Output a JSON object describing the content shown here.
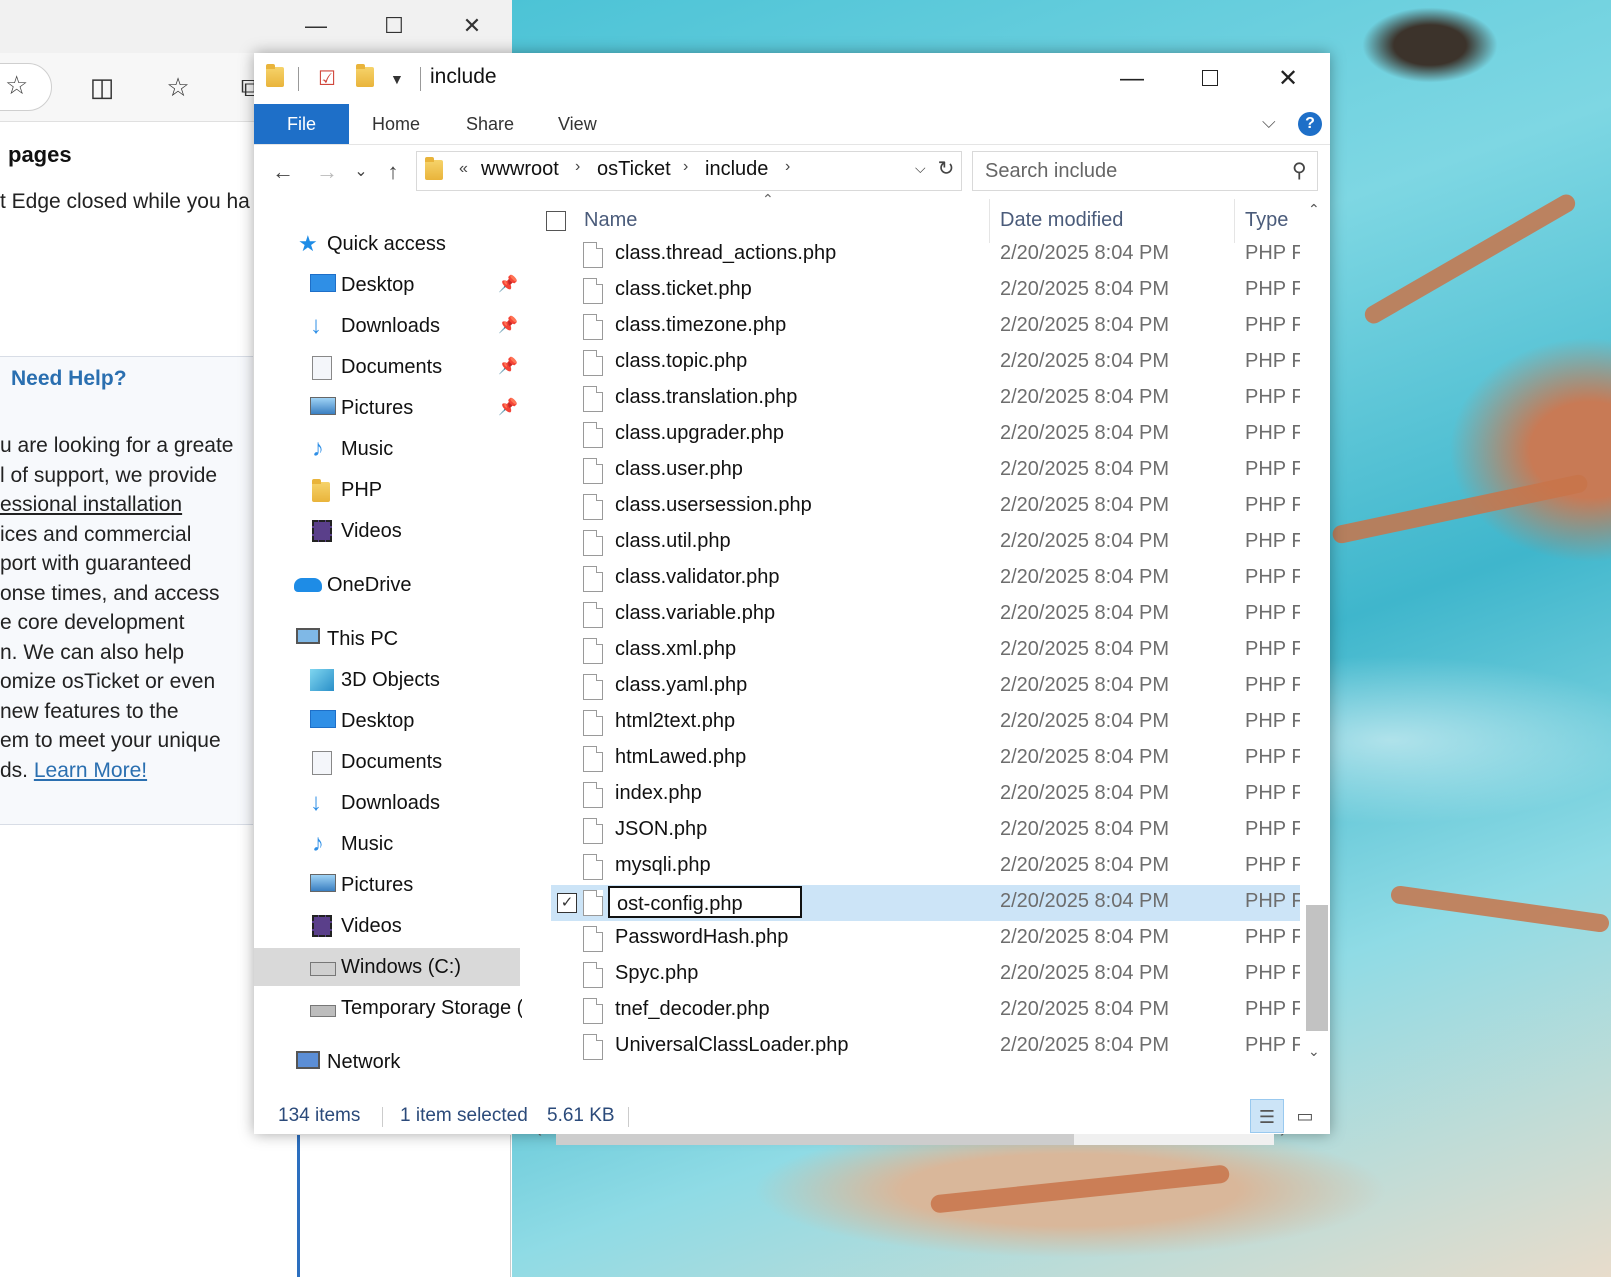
{
  "edge": {
    "caption_min": "—",
    "caption_max": "☐",
    "caption_close": "✕",
    "heading": "pages",
    "restore_line": "t Edge closed while you ha",
    "help_title": "Need Help?",
    "help_lines": [
      "u are looking for a greate",
      "l of support, we provide",
      "essional installation",
      "ices and commercial",
      "port with guaranteed",
      "onse times, and access",
      "e core development",
      "n. We can also help",
      "omize osTicket or even",
      "new features to the",
      "em to meet your unique",
      "ds. "
    ],
    "help_link": "Learn More!"
  },
  "window": {
    "title": "include",
    "minimize": "—",
    "close": "✕"
  },
  "ribbon": {
    "tabs": [
      "File",
      "Home",
      "Share",
      "View"
    ],
    "help": "?"
  },
  "nav": {
    "back": "←",
    "forward": "→",
    "recent": "⌄",
    "up": "↑",
    "overflow": "«",
    "breadcrumbs": [
      "wwwroot",
      "osTicket",
      "include"
    ],
    "refresh": "↻",
    "search_placeholder": "Search include"
  },
  "navpane": {
    "quick_access": "Quick access",
    "quick_items": [
      "Desktop",
      "Downloads",
      "Documents",
      "Pictures",
      "Music",
      "PHP",
      "Videos"
    ],
    "onedrive": "OneDrive",
    "this_pc": "This PC",
    "pc_items": [
      "3D Objects",
      "Desktop",
      "Documents",
      "Downloads",
      "Music",
      "Pictures",
      "Videos",
      "Windows (C:)",
      "Temporary Storage ("
    ],
    "network": "Network"
  },
  "columns": {
    "name": "Name",
    "date": "Date modified",
    "type": "Type"
  },
  "files": [
    {
      "name": "class.thread_actions.php",
      "date": "2/20/2025 8:04 PM",
      "type": "PHP File"
    },
    {
      "name": "class.ticket.php",
      "date": "2/20/2025 8:04 PM",
      "type": "PHP File"
    },
    {
      "name": "class.timezone.php",
      "date": "2/20/2025 8:04 PM",
      "type": "PHP File"
    },
    {
      "name": "class.topic.php",
      "date": "2/20/2025 8:04 PM",
      "type": "PHP File"
    },
    {
      "name": "class.translation.php",
      "date": "2/20/2025 8:04 PM",
      "type": "PHP File"
    },
    {
      "name": "class.upgrader.php",
      "date": "2/20/2025 8:04 PM",
      "type": "PHP File"
    },
    {
      "name": "class.user.php",
      "date": "2/20/2025 8:04 PM",
      "type": "PHP File"
    },
    {
      "name": "class.usersession.php",
      "date": "2/20/2025 8:04 PM",
      "type": "PHP File"
    },
    {
      "name": "class.util.php",
      "date": "2/20/2025 8:04 PM",
      "type": "PHP File"
    },
    {
      "name": "class.validator.php",
      "date": "2/20/2025 8:04 PM",
      "type": "PHP File"
    },
    {
      "name": "class.variable.php",
      "date": "2/20/2025 8:04 PM",
      "type": "PHP File"
    },
    {
      "name": "class.xml.php",
      "date": "2/20/2025 8:04 PM",
      "type": "PHP File"
    },
    {
      "name": "class.yaml.php",
      "date": "2/20/2025 8:04 PM",
      "type": "PHP File"
    },
    {
      "name": "html2text.php",
      "date": "2/20/2025 8:04 PM",
      "type": "PHP File"
    },
    {
      "name": "htmLawed.php",
      "date": "2/20/2025 8:04 PM",
      "type": "PHP File"
    },
    {
      "name": "index.php",
      "date": "2/20/2025 8:04 PM",
      "type": "PHP File"
    },
    {
      "name": "JSON.php",
      "date": "2/20/2025 8:04 PM",
      "type": "PHP File"
    },
    {
      "name": "mysqli.php",
      "date": "2/20/2025 8:04 PM",
      "type": "PHP File"
    },
    {
      "name": "ost-config.php",
      "date": "2/20/2025 8:04 PM",
      "type": "PHP File",
      "selected": true,
      "renaming": true
    },
    {
      "name": "PasswordHash.php",
      "date": "2/20/2025 8:04 PM",
      "type": "PHP File"
    },
    {
      "name": "Spyc.php",
      "date": "2/20/2025 8:04 PM",
      "type": "PHP File"
    },
    {
      "name": "tnef_decoder.php",
      "date": "2/20/2025 8:04 PM",
      "type": "PHP File"
    },
    {
      "name": "UniversalClassLoader.php",
      "date": "2/20/2025 8:04 PM",
      "type": "PHP File"
    }
  ],
  "status": {
    "count": "134 items",
    "selection": "1 item selected",
    "size": "5.61 KB"
  },
  "colors": {
    "accent": "#1e6fc8",
    "selection": "#cce4f7",
    "link": "#2a6fb0"
  }
}
